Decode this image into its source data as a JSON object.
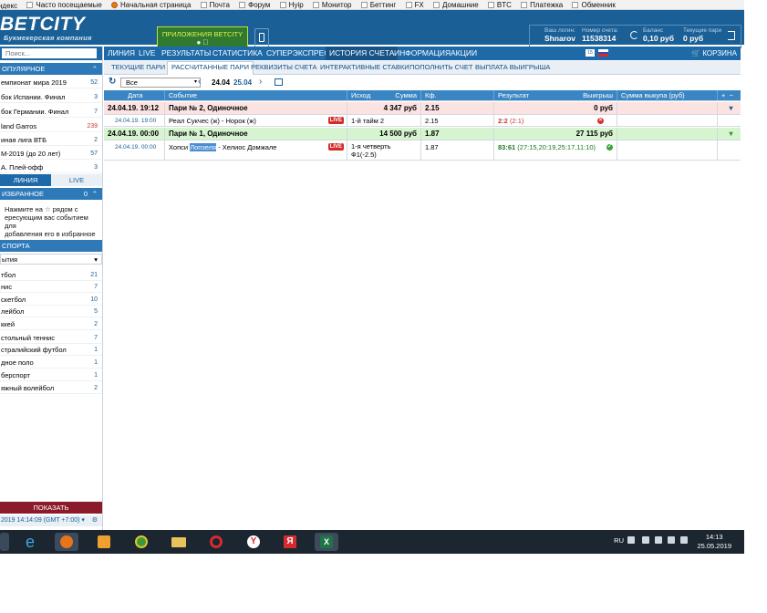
{
  "bookmarks": [
    "ндекс",
    "Часто посещаемые",
    "Начальная страница",
    "Почта",
    "Форум",
    "Нуip",
    "Монитор",
    "Беттинг",
    "FX",
    "Домашние",
    "BTC",
    "Платежка",
    "Обменник"
  ],
  "header": {
    "logo_text": "BETCITY",
    "logo_sub": "Букмекерская компания",
    "apps_label": "ПРИЛОЖЕНИЯ BETCITY",
    "apps_os": "",
    "login_label": "Ваш логин:",
    "login_value": "Shnarov",
    "account_label": "Номер счета:",
    "account_value": "11538314",
    "balance_label": "Баланс",
    "balance_value": "0,10 руб",
    "bets_label": "Текущие пари",
    "bets_value": "0 руб"
  },
  "nav": {
    "items": [
      "ЛИНИЯ",
      "LIVE",
      "РЕЗУЛЬТАТЫ",
      "СТАТИСТИКА",
      "СУПЕРЭКСПРЕСС",
      "ИСТОРИЯ СЧЕТА",
      "ИНФОРМАЦИЯ",
      "АКЦИИ"
    ],
    "active": "ИСТОРИЯ СЧЕТА",
    "lang_num": "15",
    "cart": "КОРЗИНА"
  },
  "subnav": {
    "items": [
      "ТЕКУЩИЕ ПАРИ",
      "РАССЧИТАННЫЕ ПАРИ",
      "РЕКВИЗИТЫ СЧЕТА",
      "ИНТЕРАКТИВНЫЕ СТАВКИ",
      "ПОПОЛНИТЬ СЧЕТ",
      "ВЫПЛАТА ВЫИГРЫША"
    ],
    "active": "РАССЧИТАННЫЕ ПАРИ"
  },
  "filter": {
    "select_value": "Все",
    "date_from": "24.04",
    "date_to": "25.04"
  },
  "table": {
    "headers": {
      "date": "Дата",
      "event": "Событие",
      "outcome": "Исход",
      "sum": "Сумма",
      "coef": "Кф.",
      "result": "Результат",
      "win": "Выигрыш",
      "buyout": "Сумма выкупа (руб)",
      "plus": "+",
      "minus": "−"
    },
    "bets": [
      {
        "date": "24.04.19. 19:12",
        "title": "Пари № 2, Одиночное",
        "sum": "4 347 руб",
        "coef": "2.15",
        "win": "0 руб",
        "detail": {
          "date": "24.04.19. 19:00",
          "event": "Реал Сукчес (ж) - Норок (ж)",
          "live": "LIVE",
          "outcome": "1-й тайм 2",
          "coef": "2.15",
          "score": "2:2",
          "score_detail": "(2:1)"
        }
      },
      {
        "date": "24.04.19. 00:00",
        "title": "Пари № 1, Одиночное",
        "sum": "14 500 руб",
        "coef": "1.87",
        "win": "27 115 руб",
        "detail": {
          "date": "24.04.19. 00:00",
          "event_pre": "Хопси ",
          "event_hl": "Лопзеля",
          "event_post": " - Хелиос Домжале",
          "live": "LIVE",
          "outcome_1": "1-я четверть",
          "outcome_2": "Ф1(-2.5)",
          "coef": "1.87",
          "score": "83:61",
          "score_detail": "(27:15,20:19,25:17,11:10)"
        }
      }
    ]
  },
  "sidebar": {
    "search_placeholder": "Поиск...",
    "popular_title": "ОПУЛЯРНОЕ",
    "popular_items": [
      {
        "label": "емпионат мира 2019",
        "count": "52"
      },
      {
        "label": "бок Испании. Финал",
        "count": "3"
      },
      {
        "label": "бок Германии. Финал",
        "count": "7"
      },
      {
        "label": "land Garros",
        "count": "239"
      },
      {
        "label": "иная лига ВТБ",
        "count": "2"
      },
      {
        "label": "М-2019 (до 20 лет)",
        "count": "57"
      },
      {
        "label": "А. Плей-офф",
        "count": "3"
      }
    ],
    "tab_line": "ЛИНИЯ",
    "tab_live": "LIVE",
    "fav_title": "ИЗБРАННОЕ",
    "fav_count": "0",
    "fav_text_1": "Нажмите на",
    "fav_text_2": "рядом с",
    "fav_text_3": "ересующим вас событием для",
    "fav_text_4": "добавления его в избранное",
    "sport_title": "СПОРТА",
    "sport_select": "ытия",
    "sports": [
      {
        "label": "тбол",
        "count": "21"
      },
      {
        "label": "нис",
        "count": "7"
      },
      {
        "label": "скетбол",
        "count": "10"
      },
      {
        "label": "лейбол",
        "count": "5"
      },
      {
        "label": "ккей",
        "count": "2"
      },
      {
        "label": "стольный теннис",
        "count": "7"
      },
      {
        "label": "стралийский футбол",
        "count": "1"
      },
      {
        "label": "дное поло",
        "count": "1"
      },
      {
        "label": "берспорт",
        "count": "1"
      },
      {
        "label": "яжный волейбол",
        "count": "2"
      }
    ],
    "show_button": "ПОКАЗАТЬ",
    "timezone": "2019 14:14:09 (GMT +7:00)"
  },
  "taskbar": {
    "lang": "RU",
    "time": "14:13",
    "date": "25.05.2019"
  },
  "colors": {
    "header_bg": "#1a5f95",
    "nav_bg": "#1e6aa8",
    "table_header": "#3a86c4",
    "lost_row": "#fbe3e2",
    "won_row": "#d6f4cf",
    "show_btn": "#8b1a2a"
  }
}
